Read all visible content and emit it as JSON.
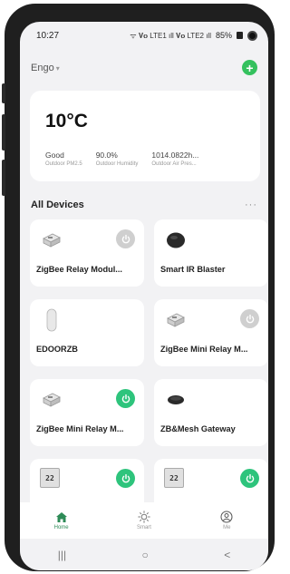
{
  "status_bar": {
    "time": "10:27",
    "signal": "ᯤ 𝐕𝐨 LTE1 ıll 𝐕𝐨 LTE2 ıll",
    "battery": "85%"
  },
  "header": {
    "home_name": "Engo",
    "caret": "▾",
    "add_label": "+"
  },
  "weather": {
    "temperature": "10°C",
    "stats": [
      {
        "value": "Good",
        "label": "Outdoor PM2.5"
      },
      {
        "value": "90.0%",
        "label": "Outdoor Humidity"
      },
      {
        "value": "1014.0822h...",
        "label": "Outdoor Air Pres..."
      }
    ]
  },
  "devices": {
    "title": "All Devices",
    "more_label": "···",
    "items": [
      {
        "name": "ZigBee Relay Modul...",
        "icon": "relay-module-icon",
        "power": "off"
      },
      {
        "name": "Smart IR Blaster",
        "icon": "ir-blaster-icon",
        "power": "none"
      },
      {
        "name": "EDOORZB",
        "icon": "door-sensor-icon",
        "power": "none"
      },
      {
        "name": "ZigBee Mini Relay M...",
        "icon": "mini-relay-icon",
        "power": "off"
      },
      {
        "name": "ZigBee Mini Relay M...",
        "icon": "mini-relay-icon",
        "power": "on"
      },
      {
        "name": "ZB&Mesh Gateway",
        "icon": "gateway-icon",
        "power": "none"
      },
      {
        "name": "",
        "icon": "thermostat-display-icon",
        "power": "on"
      },
      {
        "name": "",
        "icon": "thermostat-display-icon",
        "power": "on"
      }
    ],
    "display_value": "22"
  },
  "bottom_nav": [
    {
      "label": "Home",
      "icon": "home-icon",
      "active": true
    },
    {
      "label": "Smart",
      "icon": "sun-icon",
      "active": false
    },
    {
      "label": "Me",
      "icon": "profile-icon",
      "active": false
    }
  ],
  "system_nav": {
    "recents": "|||",
    "home": "○",
    "back": "<"
  },
  "colors": {
    "accent_green": "#35c15e",
    "power_on": "#2ec47c",
    "power_off": "#cfcfcf",
    "nav_active": "#2e8b57"
  }
}
